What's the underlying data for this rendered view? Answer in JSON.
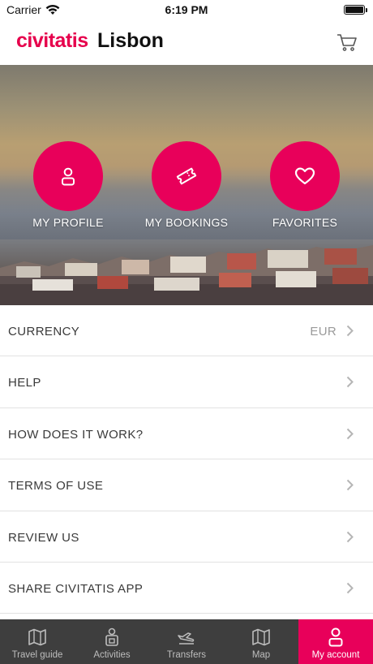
{
  "status_bar": {
    "carrier": "Carrier",
    "time": "6:19 PM"
  },
  "header": {
    "brand": "civitatis",
    "city": "Lisbon",
    "cart_icon": "cart-icon"
  },
  "hero_actions": [
    {
      "label": "MY PROFILE",
      "icon": "user-icon"
    },
    {
      "label": "MY BOOKINGS",
      "icon": "ticket-icon"
    },
    {
      "label": "FAVORITES",
      "icon": "heart-icon"
    }
  ],
  "menu": [
    {
      "label": "CURRENCY",
      "value": "EUR"
    },
    {
      "label": "HELP"
    },
    {
      "label": "HOW DOES IT WORK?"
    },
    {
      "label": "TERMS OF USE"
    },
    {
      "label": "REVIEW US"
    },
    {
      "label": "SHARE CIVITATIS APP"
    }
  ],
  "tabbar": [
    {
      "label": "Travel guide",
      "icon": "guide-map-icon"
    },
    {
      "label": "Activities",
      "icon": "activities-icon"
    },
    {
      "label": "Transfers",
      "icon": "plane-icon"
    },
    {
      "label": "Map",
      "icon": "map-icon"
    },
    {
      "label": "My account",
      "icon": "account-icon",
      "active": true
    }
  ],
  "colors": {
    "brand": "#e6004c",
    "accent": "#e8005a",
    "tabbar_bg": "#3e3e3e"
  }
}
